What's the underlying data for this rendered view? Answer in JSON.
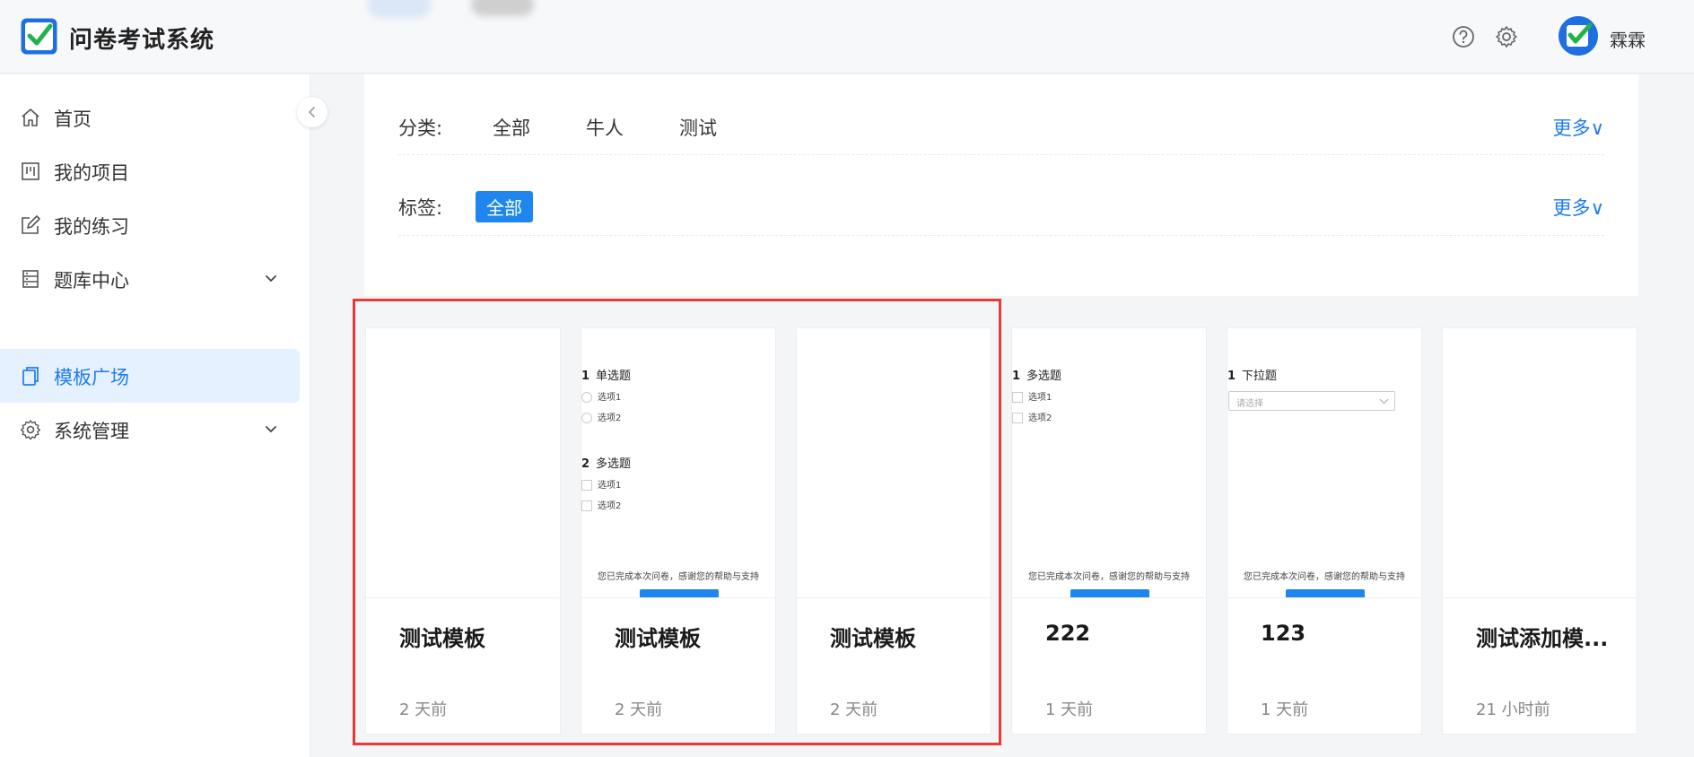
{
  "app": {
    "title": "问卷考试系统"
  },
  "header": {
    "help_icon": "help-circle-icon",
    "settings_icon": "gear-icon",
    "user_name": "霖霖"
  },
  "sidebar": {
    "items": [
      {
        "label": "首页",
        "icon": "home-icon",
        "has_chevron": false,
        "active": false
      },
      {
        "label": "我的项目",
        "icon": "project-icon",
        "has_chevron": false,
        "active": false
      },
      {
        "label": "我的练习",
        "icon": "edit-icon",
        "has_chevron": false,
        "active": false
      },
      {
        "label": "题库中心",
        "icon": "database-icon",
        "has_chevron": true,
        "active": false
      },
      {
        "label": "模板广场",
        "icon": "copy-icon",
        "has_chevron": false,
        "active": true
      },
      {
        "label": "系统管理",
        "icon": "settings-icon",
        "has_chevron": true,
        "active": false
      }
    ]
  },
  "filters": {
    "category": {
      "label": "分类:",
      "options": [
        "全部",
        "牛人",
        "测试"
      ],
      "more": "更多∨"
    },
    "tag": {
      "label": "标签:",
      "selected": "全部",
      "more": "更多∨"
    }
  },
  "cards": [
    {
      "title": "测试模板",
      "time": "2 天前",
      "preview": "blank"
    },
    {
      "title": "测试模板",
      "time": "2 天前",
      "preview": "single_multi",
      "q1_num": "1",
      "q1_title": "单选题",
      "q1_opts": [
        "选项1",
        "选项2"
      ],
      "q2_num": "2",
      "q2_title": "多选题",
      "q2_opts": [
        "选项1",
        "选项2"
      ],
      "done": "您已完成本次问卷，感谢您的帮助与支持"
    },
    {
      "title": "测试模板",
      "time": "2 天前",
      "preview": "blank"
    },
    {
      "title": "222",
      "time": "1 天前",
      "preview": "multi",
      "q1_num": "1",
      "q1_title": "多选题",
      "q1_opts": [
        "选项1",
        "选项2"
      ],
      "done": "您已完成本次问卷，感谢您的帮助与支持"
    },
    {
      "title": "123",
      "time": "1 天前",
      "preview": "select",
      "q1_num": "1",
      "q1_title": "下拉题",
      "placeholder": "请选择",
      "done": "您已完成本次问卷，感谢您的帮助与支持"
    },
    {
      "title": "测试添加模...",
      "time": "21 小时前",
      "preview": "blank"
    }
  ],
  "colors": {
    "accent": "#1f7bf2",
    "active_bg": "#e6f1ff",
    "highlight": "#e53b3b"
  }
}
